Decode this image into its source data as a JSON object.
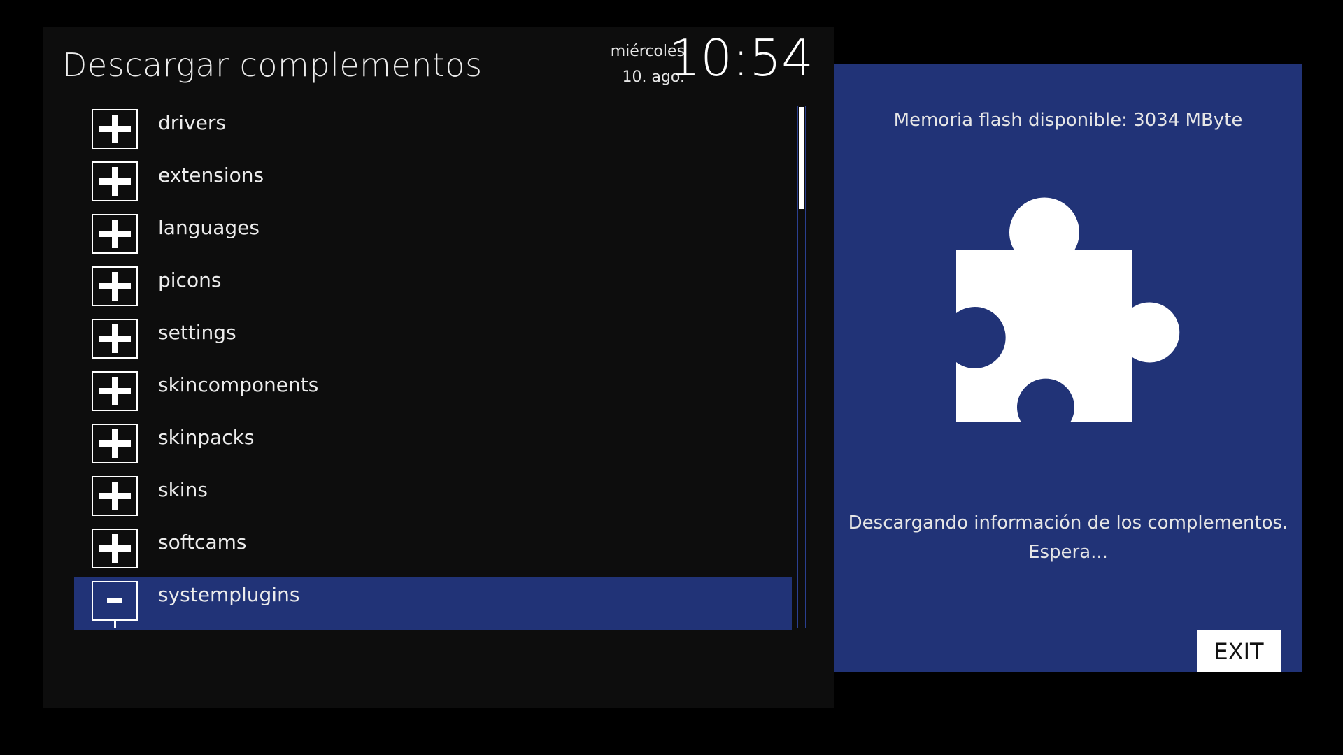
{
  "header": {
    "title": "Descargar complementos",
    "weekday": "miércoles",
    "date": "10. ago.",
    "time": "10:54"
  },
  "addon_list": {
    "items": [
      {
        "label": "drivers",
        "icon": "plus-icon",
        "expanded": false
      },
      {
        "label": "extensions",
        "icon": "plus-icon",
        "expanded": false
      },
      {
        "label": "languages",
        "icon": "plus-icon",
        "expanded": false
      },
      {
        "label": "picons",
        "icon": "plus-icon",
        "expanded": false
      },
      {
        "label": "settings",
        "icon": "plus-icon",
        "expanded": false
      },
      {
        "label": "skincomponents",
        "icon": "plus-icon",
        "expanded": false
      },
      {
        "label": "skinpacks",
        "icon": "plus-icon",
        "expanded": false
      },
      {
        "label": "skins",
        "icon": "plus-icon",
        "expanded": false
      },
      {
        "label": "softcams",
        "icon": "plus-icon",
        "expanded": false
      },
      {
        "label": "systemplugins",
        "icon": "minus-icon",
        "expanded": true,
        "selected": true
      }
    ]
  },
  "info_panel": {
    "flash_memory": "Memoria flash disponible: 3034 MByte",
    "icon": "puzzle-piece-icon",
    "status_line1": "Descargando información de los complementos.",
    "status_line2": "Espera...",
    "exit_label": "EXIT"
  },
  "colors": {
    "background": "#000000",
    "panel": "#0d0d0d",
    "accent": "#213377",
    "text": "#ececec"
  }
}
